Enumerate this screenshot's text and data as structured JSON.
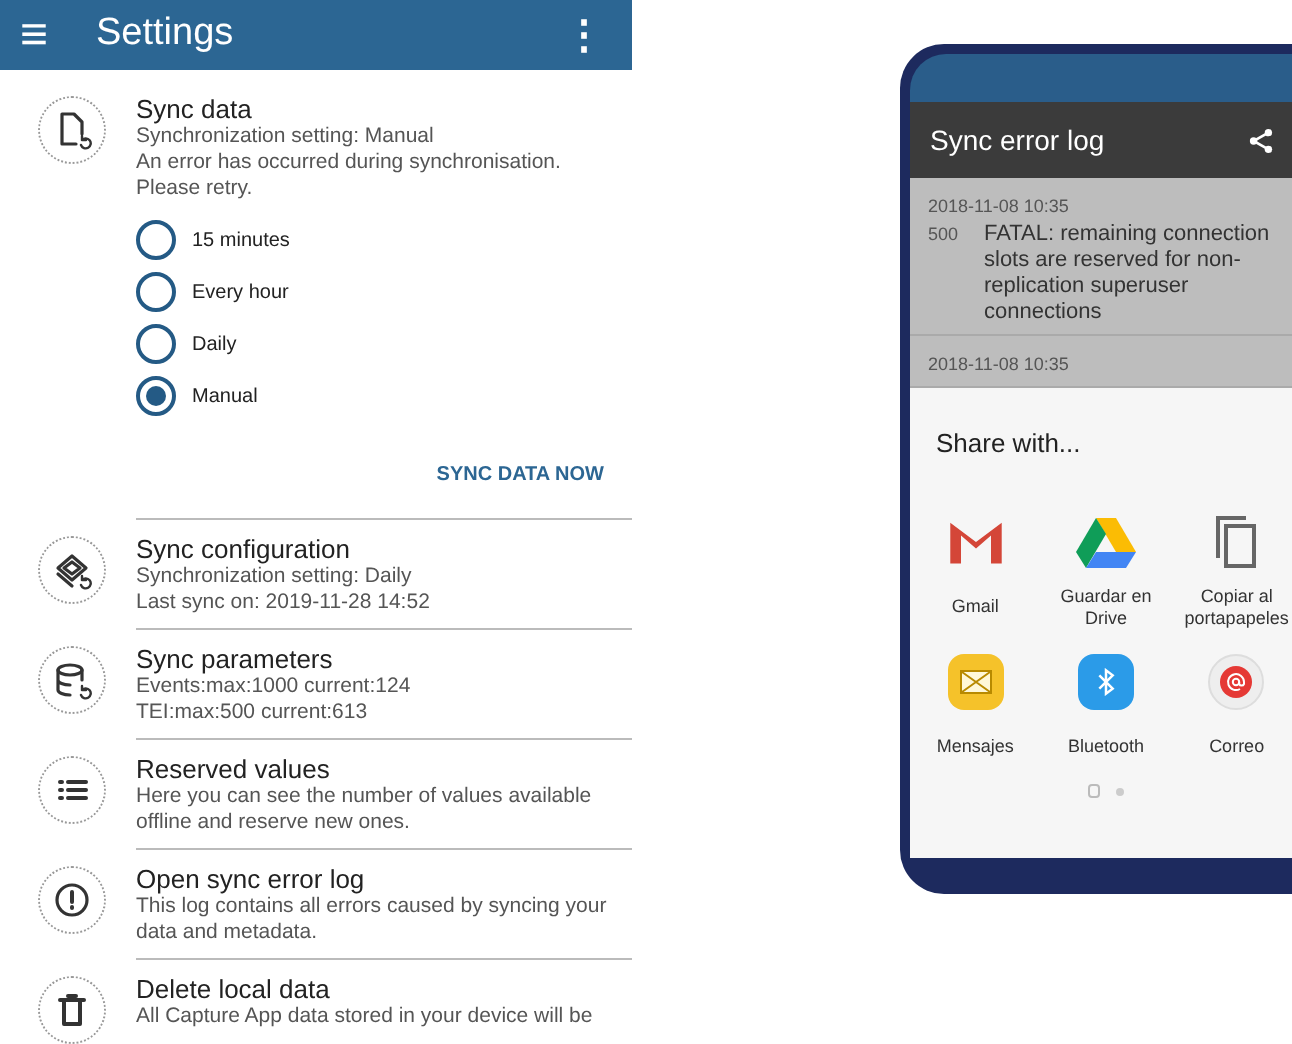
{
  "app_bar": {
    "title": "Settings",
    "menu_glyph": "≡",
    "more_glyph": "⋮"
  },
  "sync_data": {
    "title": "Sync data",
    "lines": [
      "Synchronization setting: Manual",
      "An error has occurred during synchronisation. Please retry."
    ],
    "options": [
      {
        "label": "15 minutes",
        "selected": false
      },
      {
        "label": "Every hour",
        "selected": false
      },
      {
        "label": "Daily",
        "selected": false
      },
      {
        "label": "Manual",
        "selected": true
      }
    ],
    "action": "SYNC DATA NOW"
  },
  "items": [
    {
      "title": "Sync configuration",
      "lines": [
        "Synchronization setting: Daily",
        "Last sync on: 2019-11-28 14:52"
      ]
    },
    {
      "title": "Sync parameters",
      "lines": [
        "Events:max:1000 current:124",
        "TEI:max:500 current:613"
      ]
    },
    {
      "title": "Reserved values",
      "lines": [
        "Here you can see the number of values available offline and reserve new ones."
      ]
    },
    {
      "title": "Open sync error log",
      "lines": [
        "This log contains all errors caused by syncing your data and metadata."
      ]
    },
    {
      "title": "Delete local data",
      "lines": [
        "All Capture App data stored in your device will be"
      ]
    }
  ],
  "phone": {
    "title": "Sync error log",
    "log": [
      {
        "time": "2018-11-08 10:35",
        "code": "500",
        "message": "FATAL: remaining connection slots are reserved for non-replication superuser connections"
      },
      {
        "time": "2018-11-08 10:35"
      }
    ],
    "share_title": "Share with...",
    "apps": [
      {
        "label": "Gmail"
      },
      {
        "label": "Guardar en Drive"
      },
      {
        "label": "Copiar al portapapeles"
      },
      {
        "label": "Mensajes"
      },
      {
        "label": "Bluetooth"
      },
      {
        "label": "Correo"
      }
    ],
    "pages": [
      {
        "selected": true
      },
      {
        "selected": false
      }
    ]
  }
}
